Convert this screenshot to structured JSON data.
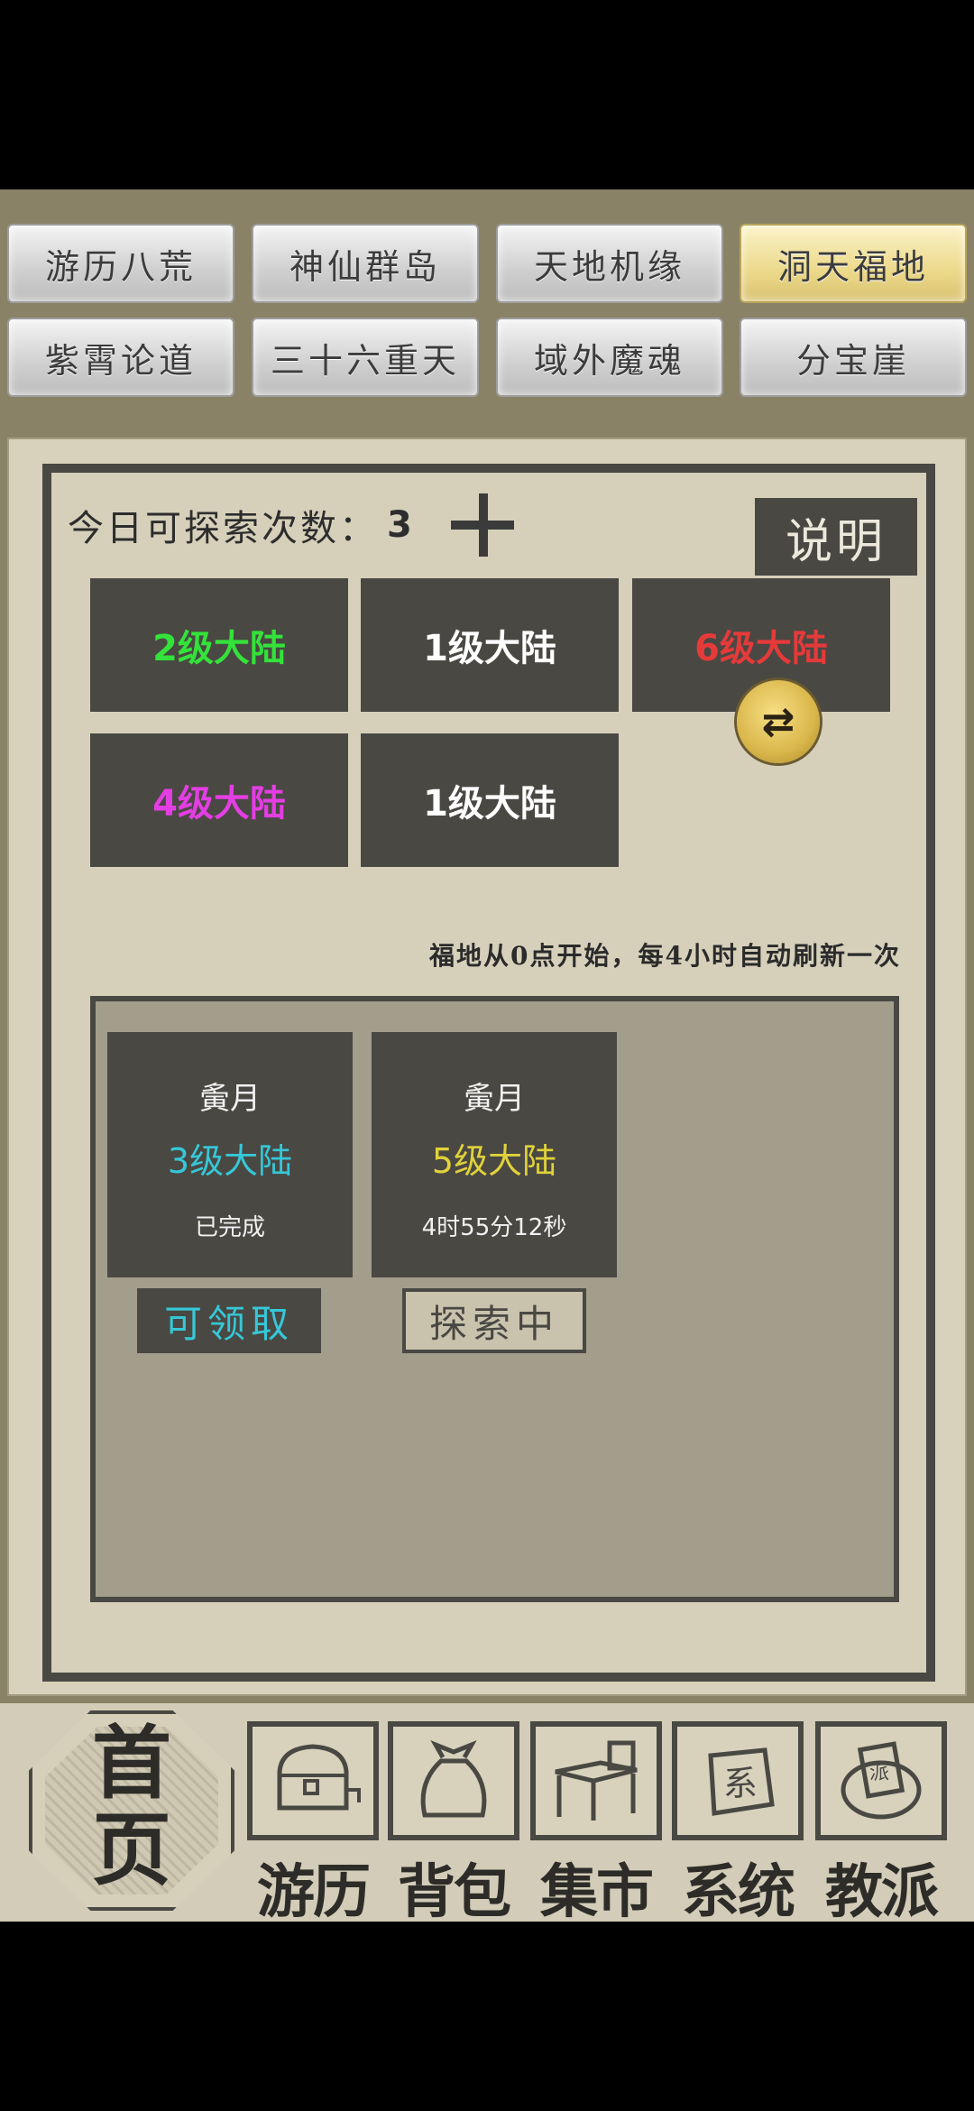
{
  "tabs": [
    {
      "label": "游历八荒"
    },
    {
      "label": "神仙群岛"
    },
    {
      "label": "天地机缘"
    },
    {
      "label": "洞天福地"
    },
    {
      "label": "紫霄论道"
    },
    {
      "label": "三十六重天"
    },
    {
      "label": "域外魔魂"
    },
    {
      "label": "分宝崖"
    }
  ],
  "active_tab": "洞天福地",
  "explore": {
    "count_label": "今日可探索次数：",
    "count": "3",
    "help_label": "说明",
    "refresh_note": "福地从0点开始，每4小时自动刷新一次"
  },
  "lands": [
    {
      "label": "2级大陆",
      "color": "#33e23a"
    },
    {
      "label": "1级大陆",
      "color": "#ffffff"
    },
    {
      "label": "6级大陆",
      "color": "#e53a3a"
    },
    {
      "label": "4级大陆",
      "color": "#e33ee3"
    },
    {
      "label": "1级大陆",
      "color": "#ffffff"
    }
  ],
  "cards": [
    {
      "name": "夤月",
      "land": "3级大陆",
      "land_color": "#35c8d8",
      "status": "已完成",
      "button": "可领取"
    },
    {
      "name": "夤月",
      "land": "5级大陆",
      "land_color": "#e0d23a",
      "status": "4时55分12秒",
      "button": "探索中"
    }
  ],
  "nav": {
    "home_line1": "首",
    "home_line2": "页",
    "items": [
      {
        "label": "游历",
        "icon": "chest-icon"
      },
      {
        "label": "背包",
        "icon": "bag-icon"
      },
      {
        "label": "集市",
        "icon": "market-stall-icon"
      },
      {
        "label": "系统",
        "icon": "system-seal-icon"
      },
      {
        "label": "教派",
        "icon": "sect-icon"
      }
    ]
  }
}
